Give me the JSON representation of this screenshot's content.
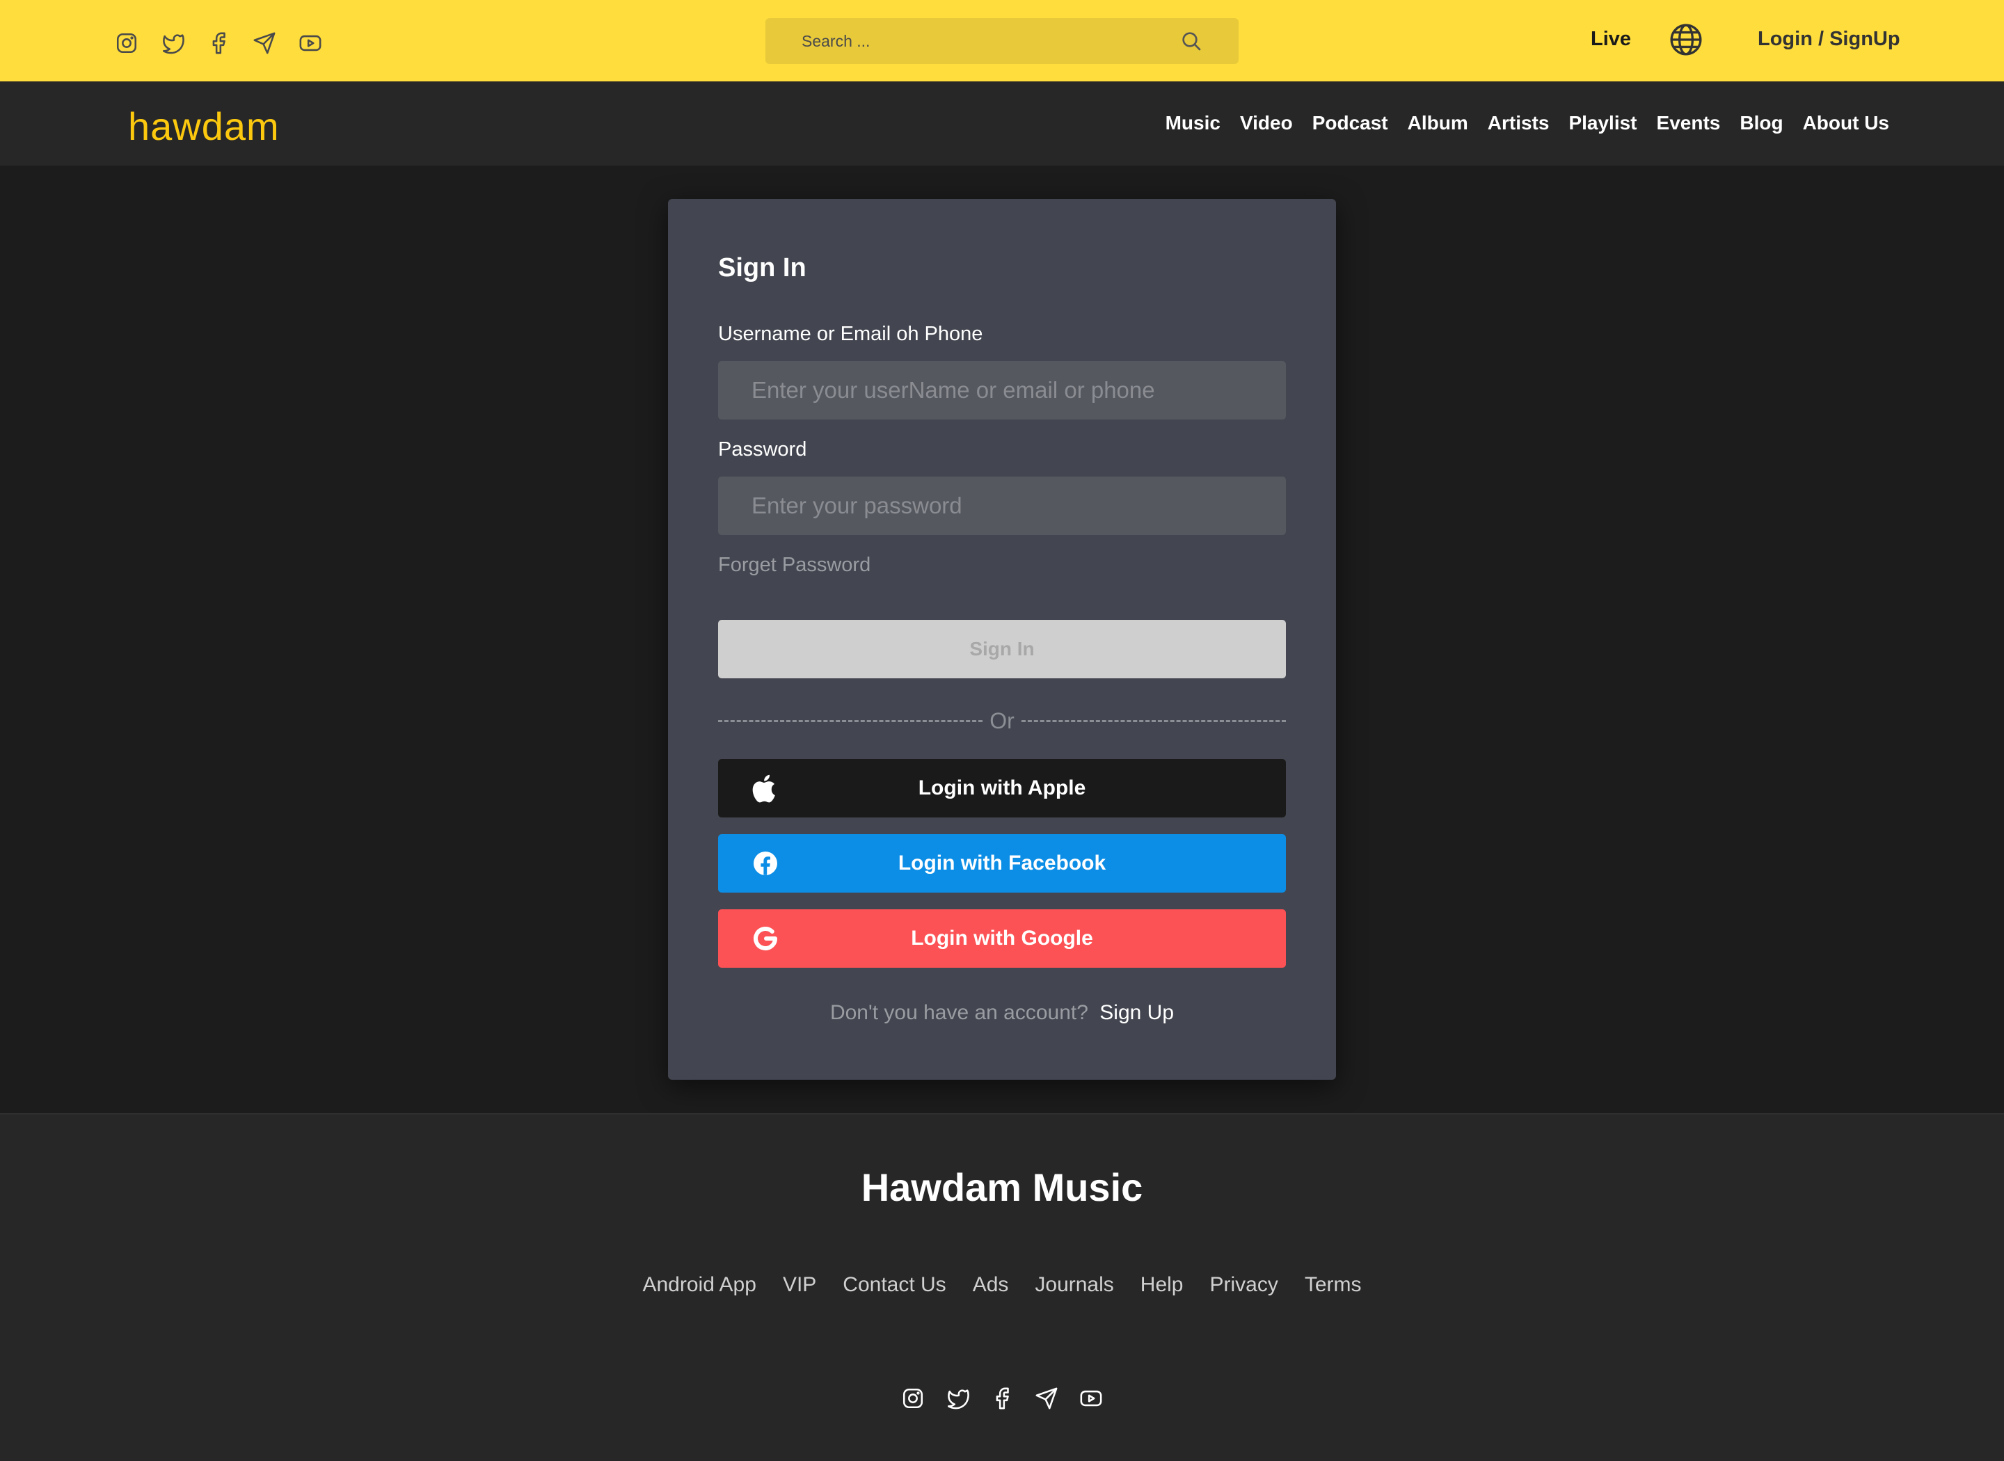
{
  "header": {
    "social_icons": [
      "instagram-icon",
      "twitter-icon",
      "facebook-icon",
      "telegram-icon",
      "youtube-icon"
    ],
    "search": {
      "placeholder": "Search ..."
    },
    "live_label": "Live",
    "login_label": "Login / SignUp"
  },
  "nav": {
    "logo": "hawdam",
    "items": [
      {
        "label": "Music"
      },
      {
        "label": "Video"
      },
      {
        "label": "Podcast"
      },
      {
        "label": "Album"
      },
      {
        "label": "Artists"
      },
      {
        "label": "Playlist"
      },
      {
        "label": "Events"
      },
      {
        "label": "Blog"
      },
      {
        "label": "About Us"
      }
    ]
  },
  "signin": {
    "title": "Sign In",
    "username_label": "Username or Email oh Phone",
    "username_placeholder": "Enter your userName or email or phone",
    "password_label": "Password",
    "password_placeholder": "Enter your password",
    "forget_label": "Forget Password",
    "submit_label": "Sign In",
    "divider_label": "Or",
    "apple_label": "Login with Apple",
    "facebook_label": "Login with Facebook",
    "google_label": "Login with Google",
    "account_prompt": "Don't you have an account?",
    "signup_label": "Sign Up"
  },
  "footer": {
    "title": "Hawdam Music",
    "links": [
      {
        "label": "Android App"
      },
      {
        "label": "VIP"
      },
      {
        "label": "Contact Us"
      },
      {
        "label": "Ads"
      },
      {
        "label": "Journals"
      },
      {
        "label": "Help"
      },
      {
        "label": "Privacy"
      },
      {
        "label": "Terms"
      }
    ]
  },
  "colors": {
    "topbar": "#fedd3d",
    "accent": "#fdc90f",
    "facebook": "#0c8ee6",
    "google": "#fc5255",
    "apple": "#1a1a1a"
  }
}
